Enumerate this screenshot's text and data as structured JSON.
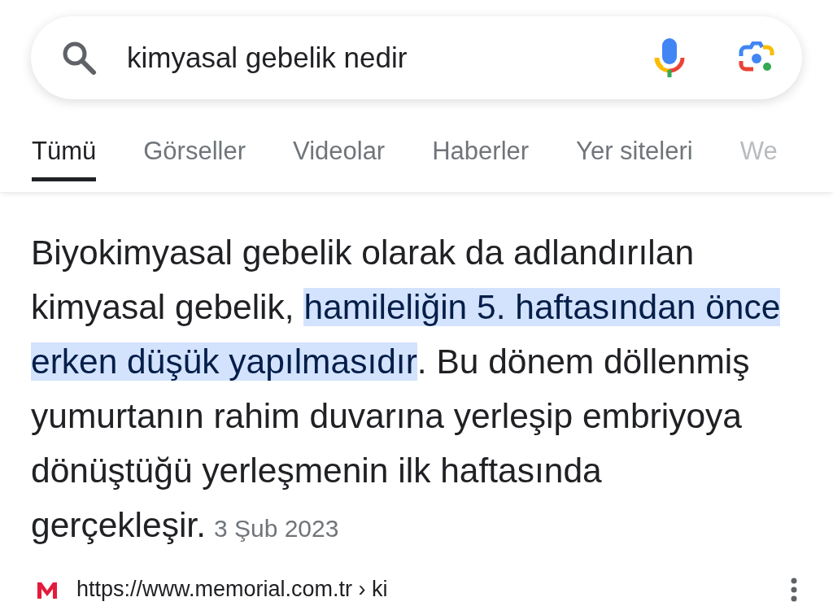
{
  "search": {
    "query": "kimyasal gebelik nedir"
  },
  "tabs": [
    {
      "label": "Tümü",
      "selected": true
    },
    {
      "label": "Görseller",
      "selected": false
    },
    {
      "label": "Videolar",
      "selected": false
    },
    {
      "label": "Haberler",
      "selected": false
    },
    {
      "label": "Yer siteleri",
      "selected": false
    },
    {
      "label": "We",
      "selected": false
    }
  ],
  "snippet": {
    "before": "Biyokimyasal gebelik olarak da adlandırılan kimyasal gebelik, ",
    "highlight": "hamileliğin 5. haftasından önce erken düşük yapılmasıdır",
    "after": ". Bu dönem döllenmiş yumurtanın rahim duvarına yerleşip embriyoya dönüştüğü yerleşmenin ilk haftasında gerçekleşir.",
    "date": "3 Şub 2023"
  },
  "result": {
    "url": "https://www.memorial.com.tr › ki"
  }
}
